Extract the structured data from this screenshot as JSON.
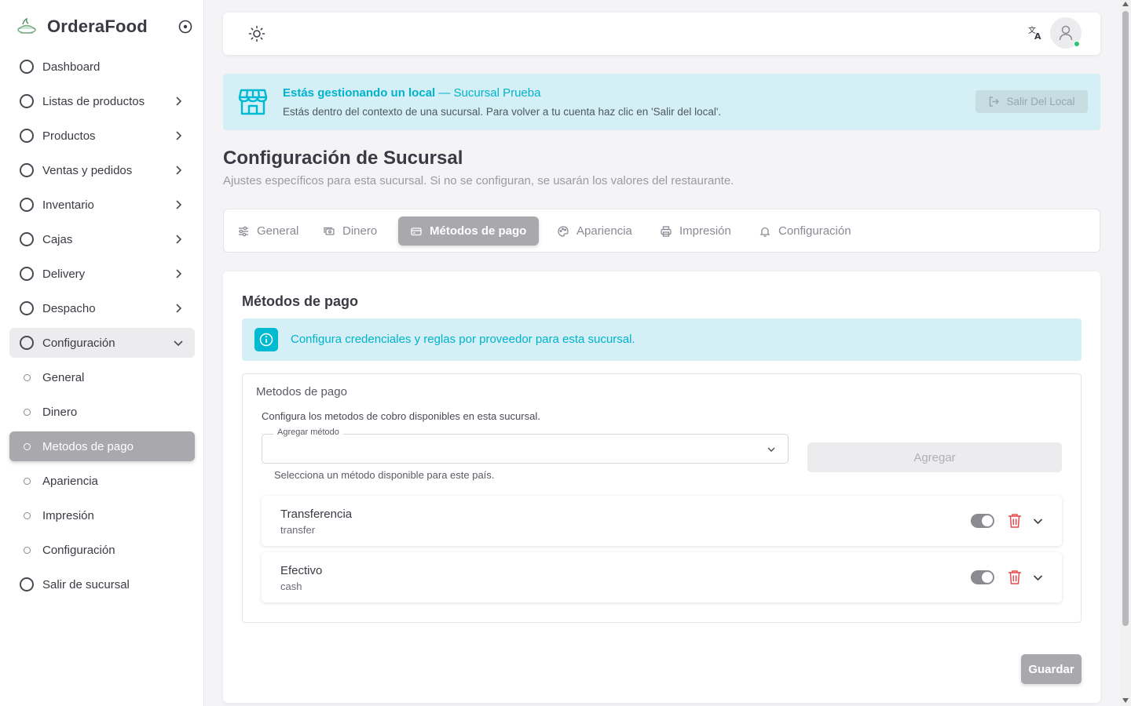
{
  "app": {
    "name": "OrderaFood"
  },
  "sidebar": {
    "items": [
      {
        "label": "Dashboard",
        "has_chevron": false
      },
      {
        "label": "Listas de productos",
        "has_chevron": true
      },
      {
        "label": "Productos",
        "has_chevron": true
      },
      {
        "label": "Ventas y pedidos",
        "has_chevron": true
      },
      {
        "label": "Inventario",
        "has_chevron": true
      },
      {
        "label": "Cajas",
        "has_chevron": true
      },
      {
        "label": "Delivery",
        "has_chevron": true
      },
      {
        "label": "Despacho",
        "has_chevron": true
      },
      {
        "label": "Configuración",
        "has_chevron": true,
        "expanded": true
      }
    ],
    "sub_items": [
      {
        "label": "General"
      },
      {
        "label": "Dinero"
      },
      {
        "label": "Metodos de pago",
        "active": true
      },
      {
        "label": "Apariencia"
      },
      {
        "label": "Impresión"
      },
      {
        "label": "Configuración"
      }
    ],
    "exit": {
      "label": "Salir de sucursal"
    }
  },
  "banner": {
    "title_bold": "Estás gestionando un local",
    "title_rest": " — Sucursal Prueba",
    "text": "Estás dentro del contexto de una sucursal. Para volver a tu cuenta haz clic en 'Salir del local'.",
    "exit_label": "Salir Del Local"
  },
  "header": {
    "title": "Configuración de Sucursal",
    "subtitle": "Ajustes específicos para esta sucursal. Si no se configuran, se usarán los valores del restaurante."
  },
  "tabs": [
    {
      "label": "General",
      "icon": "sliders-icon"
    },
    {
      "label": "Dinero",
      "icon": "cash-icon"
    },
    {
      "label": "Métodos de pago",
      "icon": "credit-card-icon",
      "active": true
    },
    {
      "label": "Apariencia",
      "icon": "palette-icon"
    },
    {
      "label": "Impresión",
      "icon": "printer-icon"
    },
    {
      "label": "Configuración",
      "icon": "bell-icon"
    }
  ],
  "card": {
    "title": "Métodos de pago",
    "info": "Configura credenciales y reglas por proveedor para esta sucursal.",
    "section_title": "Metodos de pago",
    "section_desc": "Configura los metodos de cobro disponibles en esta sucursal.",
    "select_label": "Agregar método",
    "select_value": "",
    "select_help": "Selecciona un método disponible para este país.",
    "add_label": "Agregar",
    "methods": [
      {
        "name": "Transferencia",
        "code": "transfer",
        "enabled": true
      },
      {
        "name": "Efectivo",
        "code": "cash",
        "enabled": true
      }
    ],
    "save_label": "Guardar"
  },
  "colors": {
    "accent": "#00bad1",
    "info_bg": "#d4eff5",
    "active_gray": "#a9a9ad",
    "danger": "#e5484d",
    "online": "#28c76f"
  }
}
